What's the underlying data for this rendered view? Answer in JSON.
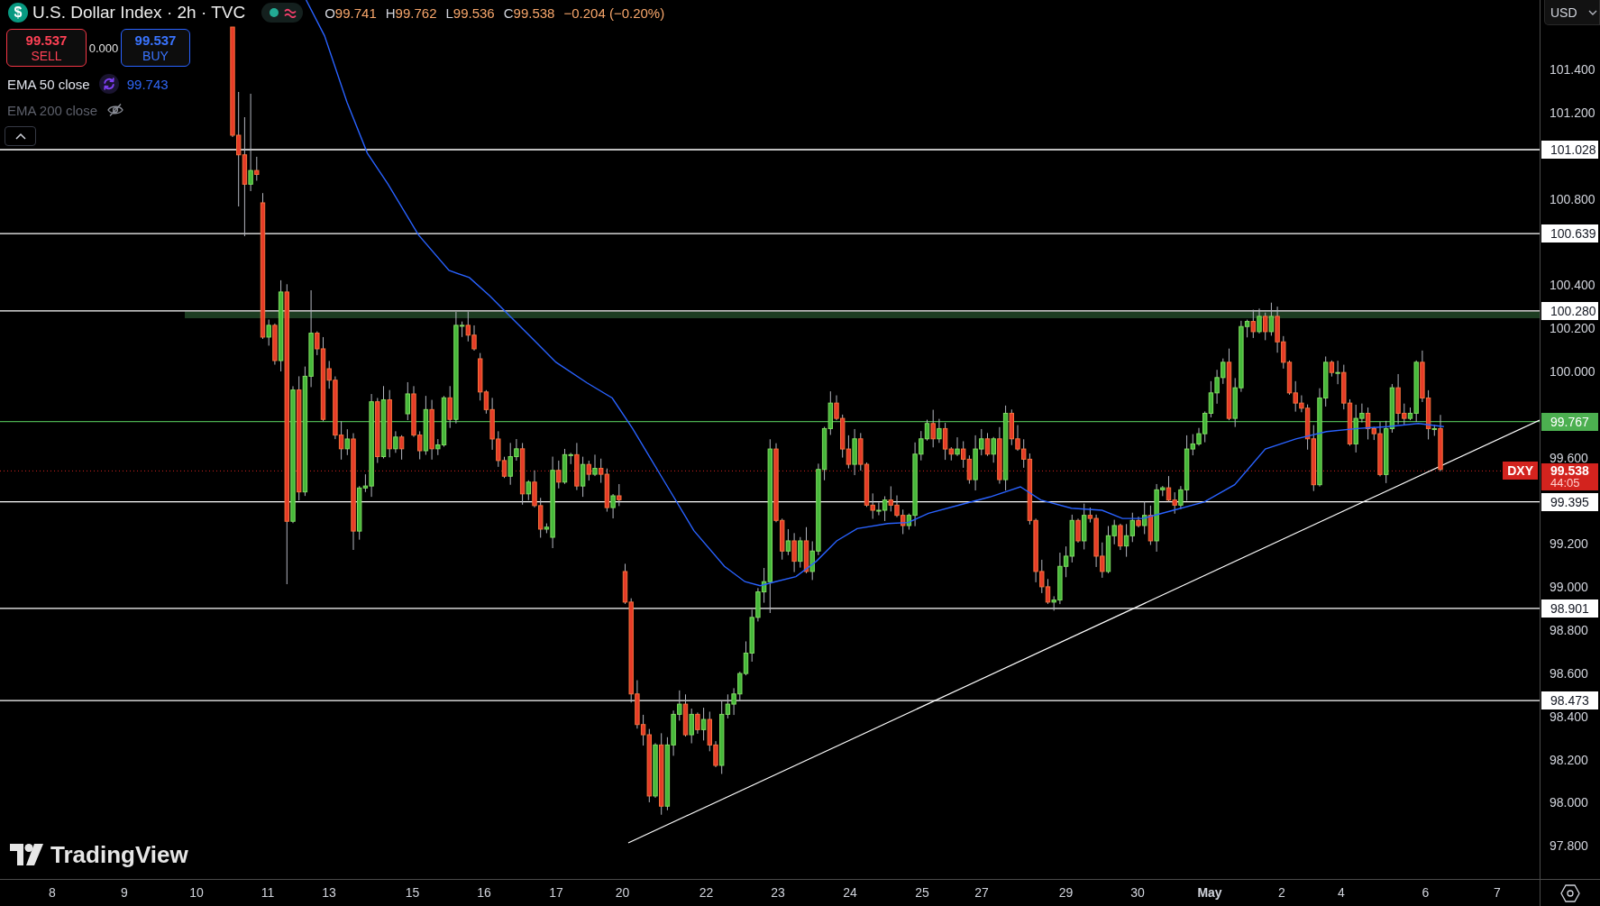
{
  "header": {
    "symbol_logo": "$",
    "title": "U.S. Dollar Index · 2h · TVC",
    "market_open": true,
    "ohlc": [
      {
        "key": "O",
        "value": "99.741"
      },
      {
        "key": "H",
        "value": "99.762"
      },
      {
        "key": "L",
        "value": "99.536"
      },
      {
        "key": "C",
        "value": "99.538"
      }
    ],
    "change": "−0.204 (−0.20%)"
  },
  "trade": {
    "sell": {
      "price": "99.537",
      "label": "SELL"
    },
    "spread": "0.000",
    "buy": {
      "price": "99.537",
      "label": "BUY"
    }
  },
  "indicators": [
    {
      "name": "EMA 50 close",
      "visible": true,
      "value": "99.743"
    },
    {
      "name": "EMA 200 close",
      "visible": false
    }
  ],
  "chart": {
    "branding": "TradingView"
  },
  "price_axis": {
    "currency": "USD",
    "ticks": [
      "101.400",
      "101.200",
      "100.800",
      "100.400",
      "100.200",
      "100.000",
      "99.600",
      "99.200",
      "99.000",
      "98.800",
      "98.600",
      "98.400",
      "98.200",
      "98.000",
      "97.800"
    ],
    "levels": [
      {
        "label": "101.028",
        "color": "#ffffff"
      },
      {
        "label": "100.639",
        "color": "#ffffff"
      },
      {
        "label": "100.280",
        "color": "#ffffff"
      },
      {
        "label": "99.767",
        "color": "#4caf50"
      },
      {
        "label": "99.395",
        "color": "#ffffff"
      },
      {
        "label": "98.901",
        "color": "#ffffff"
      },
      {
        "label": "98.473",
        "color": "#ffffff"
      }
    ],
    "last_price": {
      "symbol": "DXY",
      "price": "99.538",
      "countdown": "44:05",
      "color": "#d3231e"
    }
  },
  "time_axis": {
    "labels": [
      {
        "text": "8",
        "kind": "day"
      },
      {
        "text": "9",
        "kind": "day"
      },
      {
        "text": "10",
        "kind": "day"
      },
      {
        "text": "11",
        "kind": "day"
      },
      {
        "text": "13",
        "kind": "day"
      },
      {
        "text": "15",
        "kind": "day"
      },
      {
        "text": "16",
        "kind": "day"
      },
      {
        "text": "17",
        "kind": "day"
      },
      {
        "text": "20",
        "kind": "day"
      },
      {
        "text": "22",
        "kind": "day"
      },
      {
        "text": "23",
        "kind": "day"
      },
      {
        "text": "24",
        "kind": "day"
      },
      {
        "text": "25",
        "kind": "day"
      },
      {
        "text": "27",
        "kind": "day"
      },
      {
        "text": "29",
        "kind": "day"
      },
      {
        "text": "30",
        "kind": "day"
      },
      {
        "text": "May",
        "kind": "month"
      },
      {
        "text": "2",
        "kind": "day"
      },
      {
        "text": "4",
        "kind": "day"
      },
      {
        "text": "6",
        "kind": "day"
      },
      {
        "text": "7",
        "kind": "day"
      }
    ]
  }
}
